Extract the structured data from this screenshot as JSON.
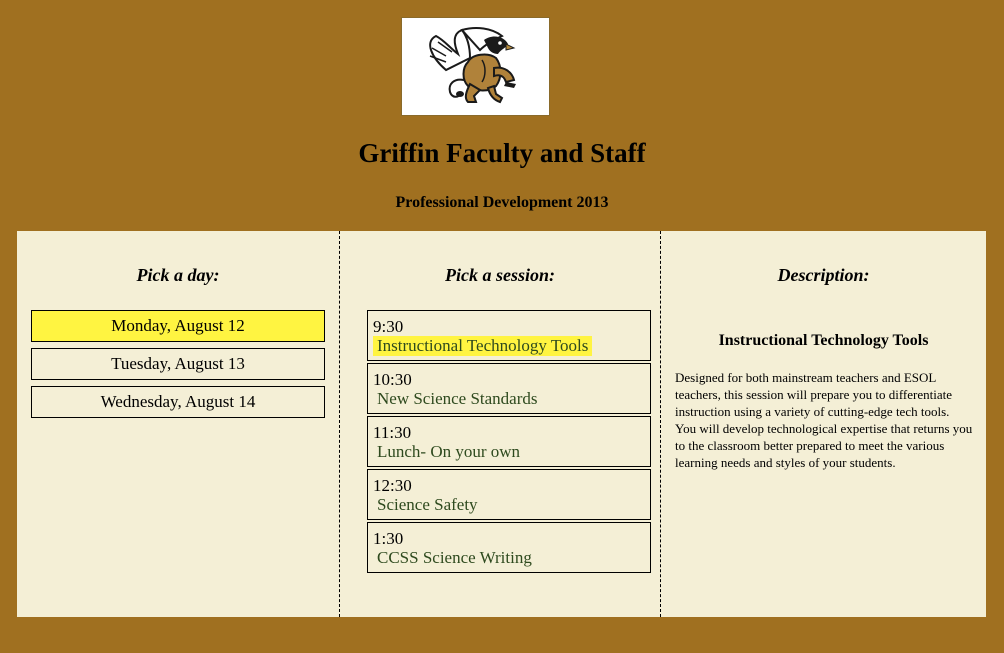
{
  "header": {
    "logo_name": "griffin-logo",
    "title": "Griffin Faculty and Staff",
    "subtitle": "Professional Development 2013"
  },
  "day_column": {
    "heading": "Pick a day:",
    "days": [
      {
        "label": "Monday, August 12",
        "selected": true
      },
      {
        "label": "Tuesday, August 13",
        "selected": false
      },
      {
        "label": "Wednesday, August 14",
        "selected": false
      }
    ]
  },
  "session_column": {
    "heading": "Pick a session:",
    "sessions": [
      {
        "time": "9:30",
        "name": "Instructional Technology Tools",
        "selected": true
      },
      {
        "time": "10:30",
        "name": "New Science Standards",
        "selected": false
      },
      {
        "time": "11:30",
        "name": "Lunch- On your own",
        "selected": false
      },
      {
        "time": "12:30",
        "name": "Science Safety",
        "selected": false
      },
      {
        "time": "1:30",
        "name": "CCSS Science Writing",
        "selected": false
      }
    ]
  },
  "description_column": {
    "heading": "Description:",
    "title": "Instructional Technology Tools",
    "body": "Designed for both mainstream teachers and ESOL teachers, this session will prepare you to differentiate instruction using a variety of cutting-edge tech tools. You will develop technological expertise that returns you to the classroom better prepared to meet the various learning needs and styles of your students."
  },
  "colors": {
    "page_background": "#a07020",
    "panel_background": "#f4efd6",
    "highlight": "#fff441",
    "session_name_text": "#2e4a1e"
  }
}
